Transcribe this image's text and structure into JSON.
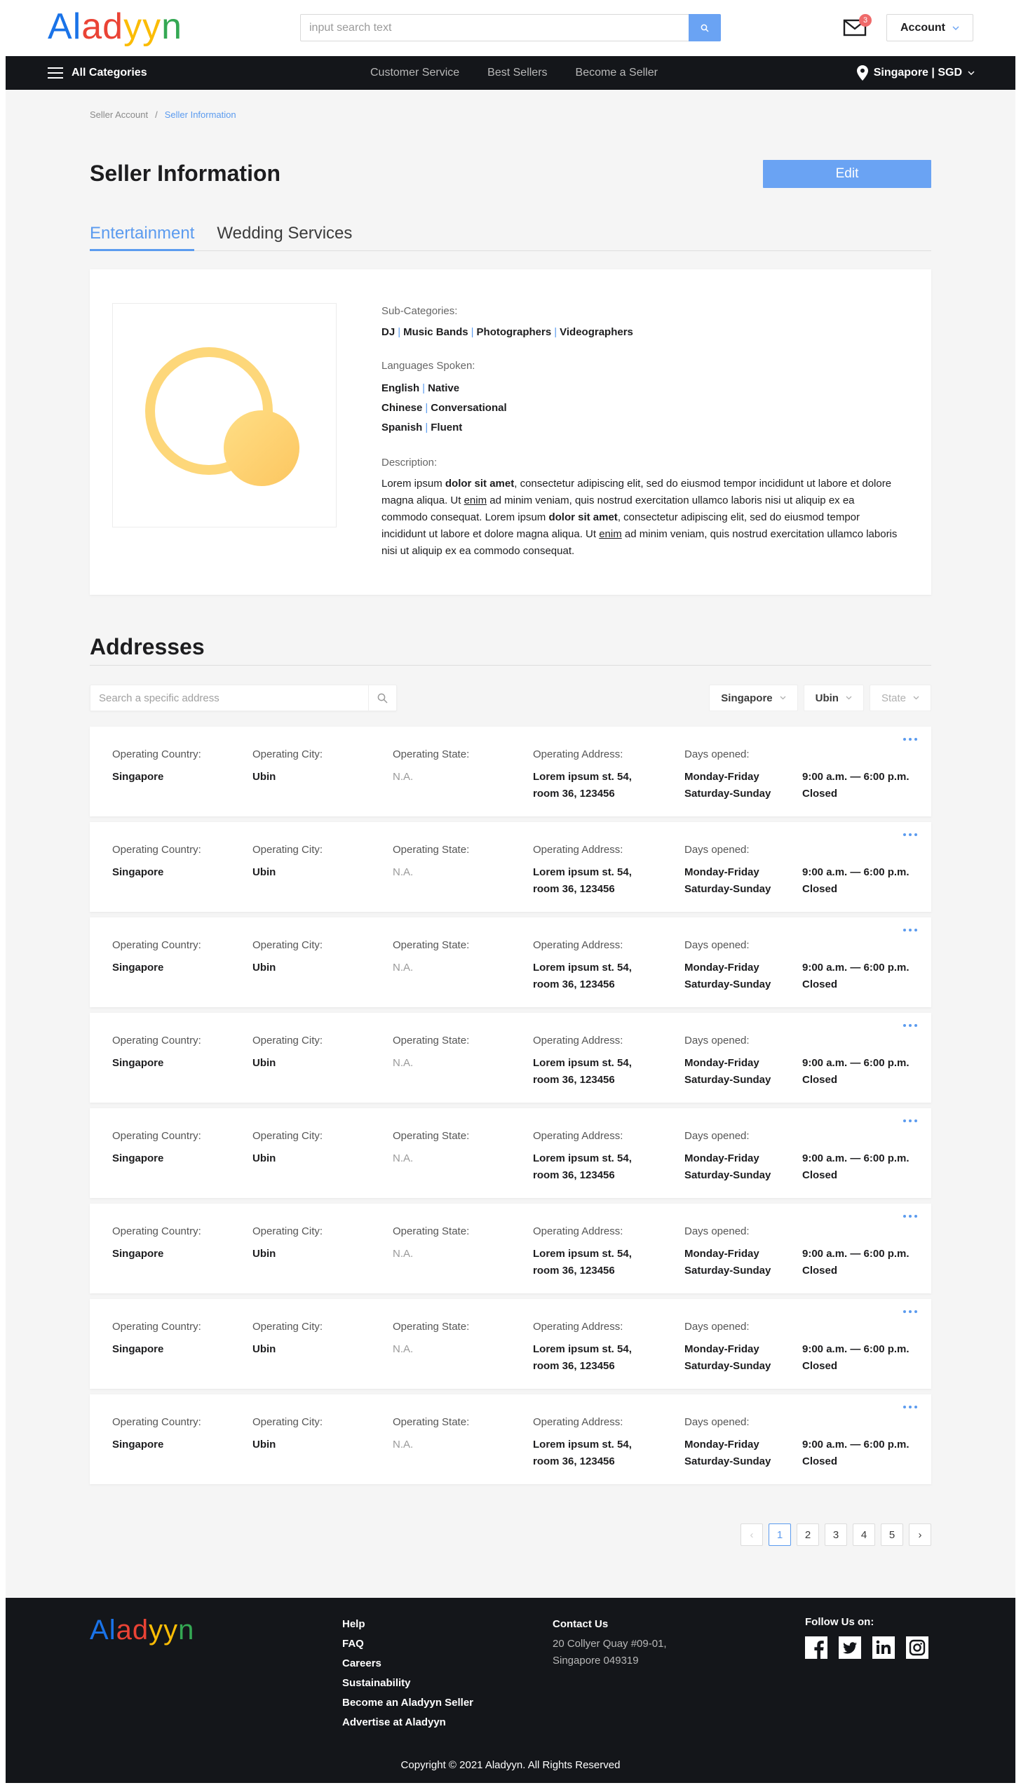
{
  "brand": {
    "logo_letters": [
      {
        "ch": "A",
        "color": "#1a73e8"
      },
      {
        "ch": "l",
        "color": "#1a73e8"
      },
      {
        "ch": "a",
        "color": "#ea4335"
      },
      {
        "ch": "d",
        "color": "#ea4335"
      },
      {
        "ch": "y",
        "color": "#fbbc05"
      },
      {
        "ch": "y",
        "color": "#fbbc05"
      },
      {
        "ch": "n",
        "color": "#34a853"
      }
    ]
  },
  "header": {
    "search_placeholder": "input search text",
    "mail_badge": "3",
    "account_label": "Account"
  },
  "nav": {
    "all_categories": "All Categories",
    "links": [
      "Customer Service",
      "Best Sellers",
      "Become a Seller"
    ],
    "location": "Singapore | SGD"
  },
  "breadcrumb": {
    "parent": "Seller Account",
    "separator": "/",
    "current": "Seller Information"
  },
  "page": {
    "title": "Seller Information",
    "edit_label": "Edit",
    "tabs": [
      {
        "label": "Entertainment",
        "active": true
      },
      {
        "label": "Wedding Services",
        "active": false
      }
    ]
  },
  "seller": {
    "subcategories_label": "Sub-Categories:",
    "subcategories": [
      "DJ",
      "Music Bands",
      "Photographers",
      "Videographers"
    ],
    "languages_label": "Languages Spoken:",
    "languages": [
      {
        "lang": "English",
        "level": "Native"
      },
      {
        "lang": "Chinese",
        "level": "Conversational"
      },
      {
        "lang": "Spanish",
        "level": "Fluent"
      }
    ],
    "description_label": "Description:",
    "description": [
      {
        "t": "Lorem ipsum ",
        "s": "n"
      },
      {
        "t": "dolor sit amet",
        "s": "b"
      },
      {
        "t": ", consectetur adipiscing elit, sed do eiusmod tempor incididunt ut labore et dolore magna aliqua. Ut ",
        "s": "n"
      },
      {
        "t": "enim",
        "s": "u"
      },
      {
        "t": " ad minim veniam, quis nostrud exercitation ullamco laboris nisi ut aliquip ex ea commodo consequat. Lorem ipsum ",
        "s": "n"
      },
      {
        "t": "dolor sit amet",
        "s": "b"
      },
      {
        "t": ", consectetur adipiscing elit, sed do eiusmod tempor incididunt ut labore et dolore magna aliqua. Ut ",
        "s": "n"
      },
      {
        "t": "enim",
        "s": "u"
      },
      {
        "t": " ad minim veniam, quis nostrud exercitation ullamco laboris nisi ut aliquip ex ea commodo consequat.",
        "s": "n"
      }
    ]
  },
  "addresses": {
    "title": "Addresses",
    "search_placeholder": "Search a specific address",
    "filters": [
      {
        "label": "Singapore",
        "muted": false
      },
      {
        "label": "Ubin",
        "muted": false
      },
      {
        "label": "State",
        "muted": true
      }
    ],
    "labels": {
      "country": "Operating Country:",
      "city": "Operating City:",
      "state": "Operating State:",
      "address": "Operating Address:",
      "days": "Days opened:"
    },
    "rows": [
      {
        "country": "Singapore",
        "city": "Ubin",
        "state": "N.A.",
        "address": [
          "Lorem ipsum st. 54,",
          "room 36, 123456"
        ],
        "days": [
          "Monday-Friday",
          "Saturday-Sunday"
        ],
        "hours": [
          "9:00 a.m. — 6:00 p.m.",
          "Closed"
        ]
      },
      {
        "country": "Singapore",
        "city": "Ubin",
        "state": "N.A.",
        "address": [
          "Lorem ipsum st. 54,",
          "room 36, 123456"
        ],
        "days": [
          "Monday-Friday",
          "Saturday-Sunday"
        ],
        "hours": [
          "9:00 a.m. — 6:00 p.m.",
          "Closed"
        ]
      },
      {
        "country": "Singapore",
        "city": "Ubin",
        "state": "N.A.",
        "address": [
          "Lorem ipsum st. 54,",
          "room 36, 123456"
        ],
        "days": [
          "Monday-Friday",
          "Saturday-Sunday"
        ],
        "hours": [
          "9:00 a.m. — 6:00 p.m.",
          "Closed"
        ]
      },
      {
        "country": "Singapore",
        "city": "Ubin",
        "state": "N.A.",
        "address": [
          "Lorem ipsum st. 54,",
          "room 36, 123456"
        ],
        "days": [
          "Monday-Friday",
          "Saturday-Sunday"
        ],
        "hours": [
          "9:00 a.m. — 6:00 p.m.",
          "Closed"
        ]
      },
      {
        "country": "Singapore",
        "city": "Ubin",
        "state": "N.A.",
        "address": [
          "Lorem ipsum st. 54,",
          "room 36, 123456"
        ],
        "days": [
          "Monday-Friday",
          "Saturday-Sunday"
        ],
        "hours": [
          "9:00 a.m. — 6:00 p.m.",
          "Closed"
        ]
      },
      {
        "country": "Singapore",
        "city": "Ubin",
        "state": "N.A.",
        "address": [
          "Lorem ipsum st. 54,",
          "room 36, 123456"
        ],
        "days": [
          "Monday-Friday",
          "Saturday-Sunday"
        ],
        "hours": [
          "9:00 a.m. — 6:00 p.m.",
          "Closed"
        ]
      },
      {
        "country": "Singapore",
        "city": "Ubin",
        "state": "N.A.",
        "address": [
          "Lorem ipsum st. 54,",
          "room 36, 123456"
        ],
        "days": [
          "Monday-Friday",
          "Saturday-Sunday"
        ],
        "hours": [
          "9:00 a.m. — 6:00 p.m.",
          "Closed"
        ]
      },
      {
        "country": "Singapore",
        "city": "Ubin",
        "state": "N.A.",
        "address": [
          "Lorem ipsum st. 54,",
          "room 36, 123456"
        ],
        "days": [
          "Monday-Friday",
          "Saturday-Sunday"
        ],
        "hours": [
          "9:00 a.m. — 6:00 p.m.",
          "Closed"
        ]
      }
    ]
  },
  "pagination": {
    "prev": "‹",
    "pages": [
      "1",
      "2",
      "3",
      "4",
      "5"
    ],
    "current": "1",
    "next": "›"
  },
  "footer": {
    "links": [
      "Help",
      "FAQ",
      "Careers",
      "Sustainability",
      "Become an Aladyyn Seller",
      "Advertise at Aladyyn"
    ],
    "contact_heading": "Contact Us",
    "contact_address": [
      "20 Collyer Quay #09-01,",
      "Singapore 049319"
    ],
    "follow_heading": "Follow Us on:",
    "social_icons": [
      "facebook-icon",
      "twitter-icon",
      "linkedin-icon",
      "instagram-icon"
    ],
    "copyright": "Copyright © 2021 Aladyyn. All Rights Reserved"
  },
  "colors": {
    "accent": "#5b9bef",
    "button": "#6aa3f3",
    "dark": "#14161a",
    "badge": "#ef6a6a",
    "photo_gold": "#fdd372"
  }
}
